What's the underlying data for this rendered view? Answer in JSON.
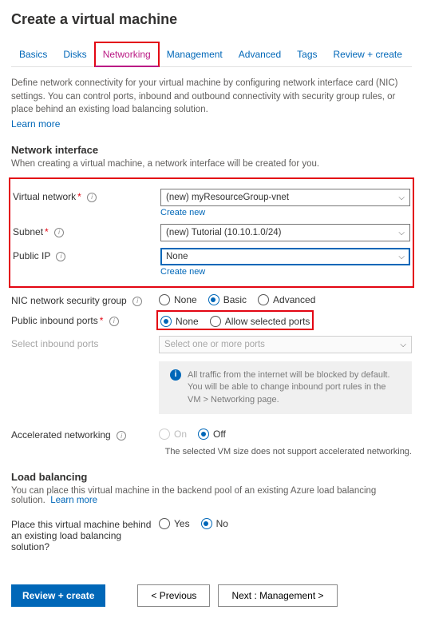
{
  "title": "Create a virtual machine",
  "tabs": {
    "basics": "Basics",
    "disks": "Disks",
    "networking": "Networking",
    "management": "Management",
    "advanced": "Advanced",
    "tags": "Tags",
    "review": "Review + create"
  },
  "intro": {
    "text": "Define network connectivity for your virtual machine by configuring network interface card (NIC) settings. You can control ports, inbound and outbound connectivity with security group rules, or place behind an existing load balancing solution.",
    "learn_more": "Learn more"
  },
  "sections": {
    "interface_title": "Network interface",
    "interface_sub": "When creating a virtual machine, a network interface will be created for you.",
    "lb_title": "Load balancing",
    "lb_sub": "You can place this virtual machine in the backend pool of an existing Azure load balancing solution.",
    "lb_learn_more": "Learn more"
  },
  "fields": {
    "vnet_label": "Virtual network",
    "vnet_value": "(new) myResourceGroup-vnet",
    "create_new": "Create new",
    "subnet_label": "Subnet",
    "subnet_value": "(new) Tutorial (10.10.1.0/24)",
    "publicip_label": "Public IP",
    "publicip_value": "None",
    "nsg_label": "NIC network security group",
    "nsg_none": "None",
    "nsg_basic": "Basic",
    "nsg_advanced": "Advanced",
    "inbound_label": "Public inbound ports",
    "inbound_none": "None",
    "inbound_allow": "Allow selected ports",
    "selectports_label": "Select inbound ports",
    "selectports_placeholder": "Select one or more ports",
    "info_text": "All traffic from the internet will be blocked by default. You will be able to change inbound port rules in the VM > Networking page.",
    "accel_label": "Accelerated networking",
    "accel_on": "On",
    "accel_off": "Off",
    "accel_note": "The selected VM size does not support accelerated networking.",
    "lbq_label": "Place this virtual machine behind an existing load balancing solution?",
    "yes": "Yes",
    "no": "No"
  },
  "buttons": {
    "review": "Review + create",
    "prev": "< Previous",
    "next": "Next : Management >"
  }
}
